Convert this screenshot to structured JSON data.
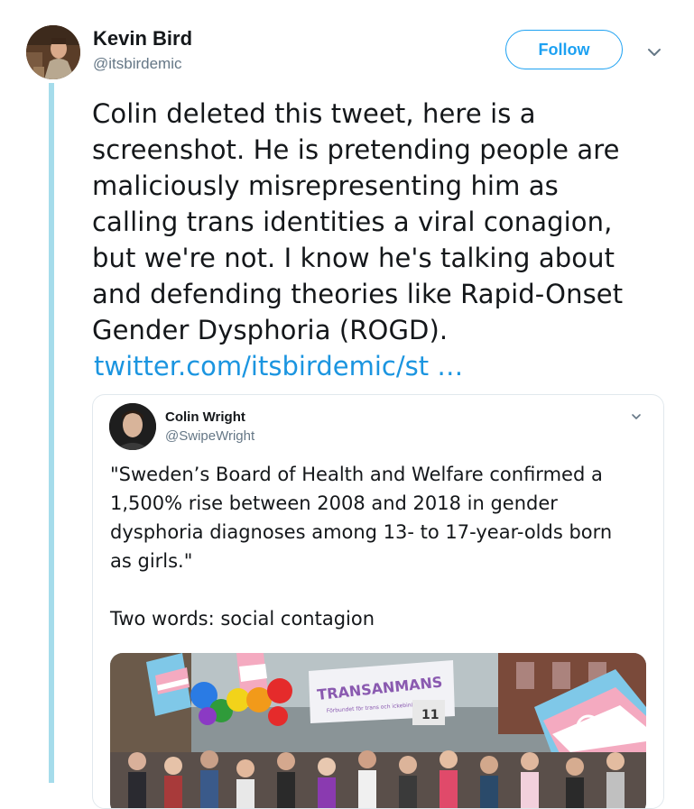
{
  "tweet": {
    "author_name": "Kevin Bird",
    "author_handle": "@itsbirdemic",
    "follow_label": "Follow",
    "text_lines": [
      "Colin deleted this tweet, here is a",
      "screenshot. He is pretending people are",
      "maliciously misrepresenting him as",
      "calling trans identities a viral conagion,",
      "but we're not. I know he's talking about",
      "and defending theories like Rapid-Onset",
      "Gender Dysphoria (ROGD)."
    ],
    "link_text": "twitter.com/itsbirdemic/st …",
    "icons": {
      "menu": "chevron-down-icon",
      "avatar": "avatar"
    }
  },
  "quoted_tweet": {
    "author_name": "Colin Wright",
    "author_handle": "@SwipeWright",
    "text_lines": [
      "\"Sweden’s Board of Health and Welfare confirmed a",
      "1,500% rise between 2008 and 2018 in gender",
      "dysphoria diagnoses among 13- to 17-year-olds born",
      "as girls.\""
    ],
    "text_line_2": "Two words: social contagion",
    "image": {
      "banner_text": "TRANSANMANS",
      "banner_subtext": "Förbundet för trans och ickebinära",
      "sign_number": "11"
    },
    "icons": {
      "menu": "chevron-down-icon"
    }
  },
  "colors": {
    "accent": "#1da1f2",
    "link": "#1b95e0",
    "thread_line": "#a5dceb",
    "secondary_text": "#657786"
  }
}
